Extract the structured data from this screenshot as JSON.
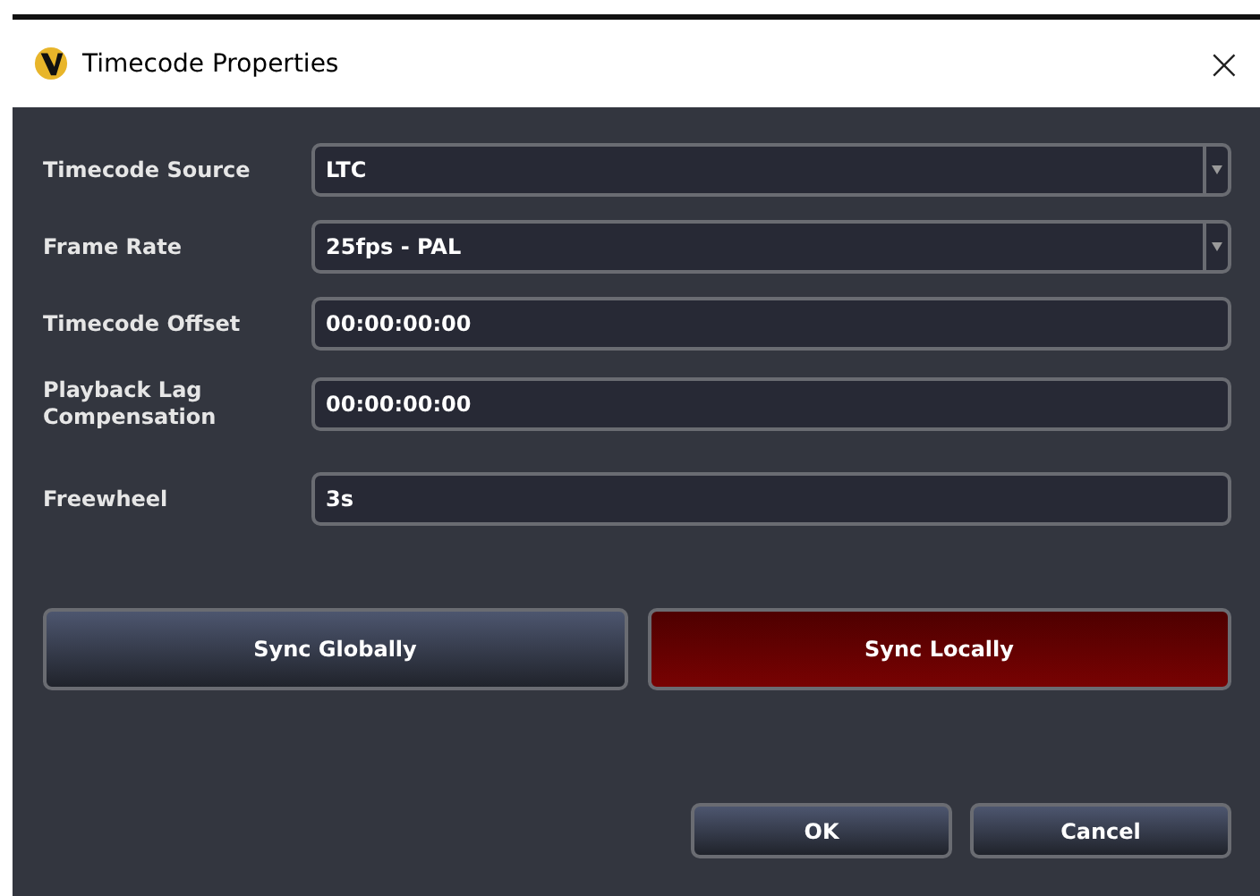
{
  "window": {
    "title": "Timecode Properties",
    "close": "×"
  },
  "fields": [
    {
      "label": "Timecode Source",
      "kind": "dropdown",
      "value": "LTC"
    },
    {
      "label": "Frame Rate",
      "kind": "dropdown",
      "value": "25fps - PAL"
    },
    {
      "label": "Timecode Offset",
      "kind": "text",
      "value": "00:00:00:00"
    },
    {
      "label": "Playback Lag Compensation",
      "kind": "text",
      "value": "00:00:00:00"
    },
    {
      "label": "Freewheel",
      "kind": "text",
      "value": "3s"
    }
  ],
  "sync_buttons": [
    {
      "label": "Sync Globally",
      "selected": false
    },
    {
      "label": "Sync Locally",
      "selected": true
    }
  ],
  "buttons": [
    "OK",
    "Cancel"
  ]
}
